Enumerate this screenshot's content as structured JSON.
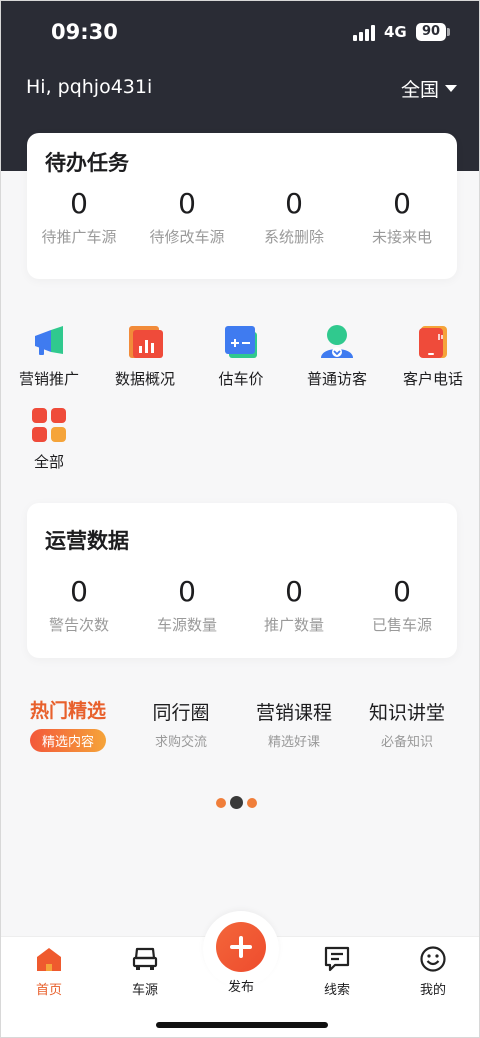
{
  "status_bar": {
    "time": "09:30",
    "network": "4G",
    "battery": "90"
  },
  "header": {
    "greeting": "Hi, pqhjo431i",
    "region": "全国"
  },
  "todo": {
    "title": "待办任务",
    "items": [
      {
        "value": "0",
        "label": "待推广车源"
      },
      {
        "value": "0",
        "label": "待修改车源"
      },
      {
        "value": "0",
        "label": "系统删除"
      },
      {
        "value": "0",
        "label": "未接来电"
      }
    ]
  },
  "shortcuts": [
    {
      "label": "营销推广",
      "icon": "megaphone-icon"
    },
    {
      "label": "数据概况",
      "icon": "bar-chart-icon"
    },
    {
      "label": "估车价",
      "icon": "calculator-icon"
    },
    {
      "label": "普通访客",
      "icon": "visitor-icon"
    },
    {
      "label": "客户电话",
      "icon": "phone-icon"
    },
    {
      "label": "全部",
      "icon": "grid-icon"
    }
  ],
  "operations": {
    "title": "运营数据",
    "items": [
      {
        "value": "0",
        "label": "警告次数"
      },
      {
        "value": "0",
        "label": "车源数量"
      },
      {
        "value": "0",
        "label": "推广数量"
      },
      {
        "value": "0",
        "label": "已售车源"
      }
    ]
  },
  "topics": [
    {
      "title": "热门精选",
      "subtitle": "精选内容",
      "active": true
    },
    {
      "title": "同行圈",
      "subtitle": "求购交流"
    },
    {
      "title": "营销课程",
      "subtitle": "精选好课"
    },
    {
      "title": "知识讲堂",
      "subtitle": "必备知识"
    }
  ],
  "tabbar": {
    "home": "首页",
    "cars": "车源",
    "publish": "发布",
    "leads": "线索",
    "mine": "我的"
  },
  "colors": {
    "accent": "#e8602c",
    "header_bg": "#2a2c35"
  }
}
